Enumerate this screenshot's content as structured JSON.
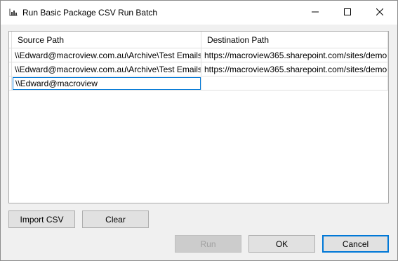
{
  "window": {
    "title": "Run Basic Package CSV Run Batch",
    "app_icon": "chart-icon"
  },
  "title_controls": {
    "minimize_icon": "minimize-icon",
    "maximize_icon": "maximize-icon",
    "close_icon": "close-icon"
  },
  "grid": {
    "columns": [
      "Source Path",
      "Destination Path"
    ],
    "rows": [
      [
        "\\\\Edward@macroview.com.au\\Archive\\Test Emails",
        "https://macroview365.sharepoint.com/sites/demo"
      ],
      [
        "\\\\Edward@macroview.com.au\\Archive\\Test Emails",
        "https://macroview365.sharepoint.com/sites/demo"
      ]
    ],
    "edit_value": "\\\\Edward@macroview"
  },
  "buttons": {
    "import_csv": "Import CSV",
    "clear": "Clear",
    "run": "Run",
    "ok": "OK",
    "cancel": "Cancel"
  },
  "colors": {
    "focus_accent": "#0078d7",
    "window_bg": "#f0f0f0",
    "button_bg": "#e1e1e1"
  }
}
